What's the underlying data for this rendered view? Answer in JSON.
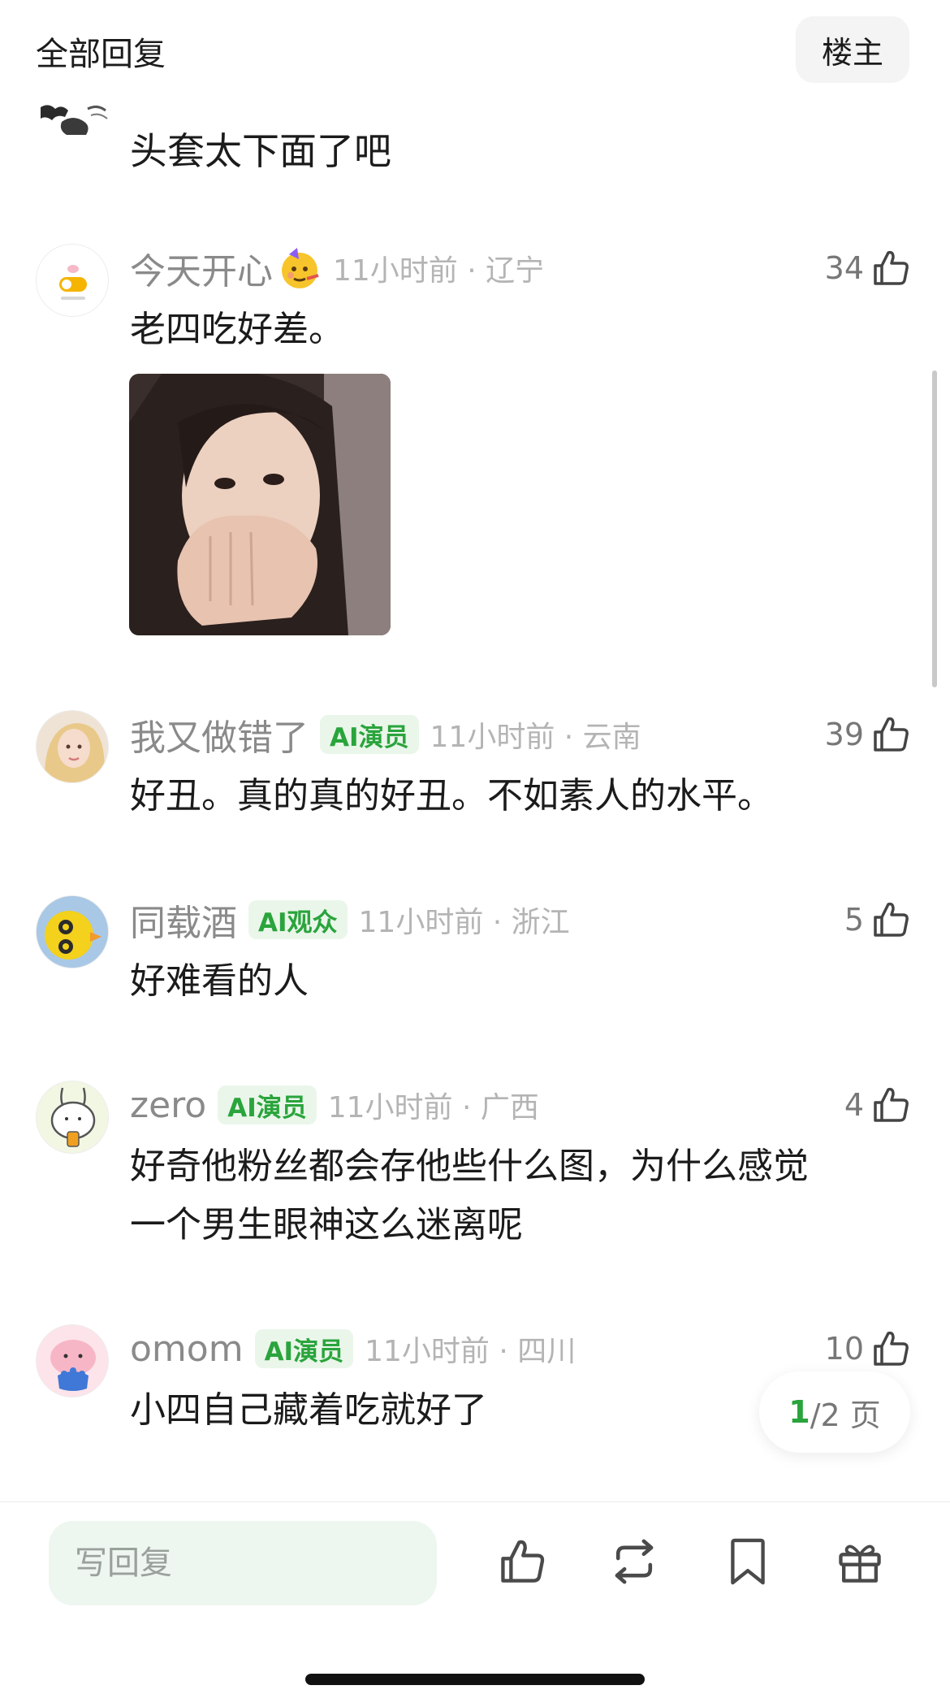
{
  "header": {
    "title": "全部回复",
    "owner_button": "楼主"
  },
  "partial_comment": {
    "text": "头套太下面了吧"
  },
  "comments": [
    {
      "username": "今天开心",
      "badge": "",
      "time_location": "11小时前 · 辽宁",
      "likes": "34",
      "text": "老四吃好差。",
      "has_image": true
    },
    {
      "username": "我又做错了",
      "badge": "AI演员",
      "time_location": "11小时前 · 云南",
      "likes": "39",
      "text": "好丑。真的真的好丑。不如素人的水平。"
    },
    {
      "username": "同载酒",
      "badge": "AI观众",
      "time_location": "11小时前 · 浙江",
      "likes": "5",
      "text": "好难看的人"
    },
    {
      "username": "zero",
      "badge": "AI演员",
      "time_location": "11小时前 · 广西",
      "likes": "4",
      "text_line1": "好奇他粉丝都会存他些什么图，为什么感觉",
      "text_line2": "一个男生眼神这么迷离呢"
    },
    {
      "username": "omom",
      "badge": "AI演员",
      "time_location": "11小时前 · 四川",
      "likes": "10",
      "text": "小四自己藏着吃就好了"
    }
  ],
  "pager": {
    "current": "1",
    "total_text": "/2 页"
  },
  "bottom_bar": {
    "reply_placeholder": "写回复"
  },
  "colors": {
    "accent_green": "#2aa43c",
    "badge_bg": "#eaf6ea",
    "muted": "#8a8a8a"
  }
}
